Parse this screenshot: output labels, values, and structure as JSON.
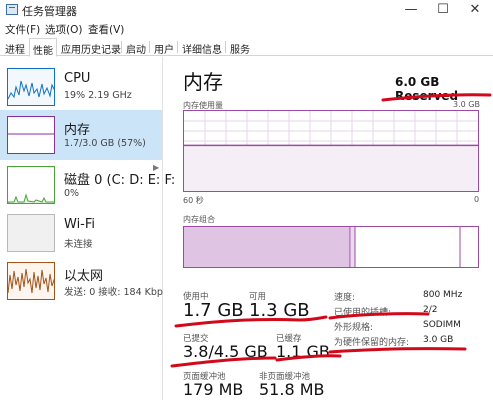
{
  "window": {
    "title": "任务管理器",
    "buttons": {
      "minimize": "—",
      "maximize": "☐",
      "close": "✕"
    }
  },
  "menu": [
    {
      "label": "文件(F)"
    },
    {
      "label": "选项(O)"
    },
    {
      "label": "查看(V)"
    }
  ],
  "tabs": [
    {
      "label": "进程",
      "active": false
    },
    {
      "label": "性能",
      "active": true
    },
    {
      "label": "应用历史记录",
      "active": false
    },
    {
      "label": "启动",
      "active": false
    },
    {
      "label": "用户",
      "active": false
    },
    {
      "label": "详细信息",
      "active": false
    },
    {
      "label": "服务",
      "active": false
    }
  ],
  "sidebar": {
    "items": [
      {
        "title": "CPU",
        "subtitle": "19% 2.19 GHz",
        "color": "#1170c8",
        "selected": false
      },
      {
        "title": "内存",
        "subtitle": "1.7/3.0 GB (57%)",
        "color": "#8b2f9a",
        "selected": true
      },
      {
        "title": "磁盘 0 (C: D: E: F:",
        "subtitle": "0%",
        "color": "#4aa338",
        "selected": false
      },
      {
        "title": "Wi-Fi",
        "subtitle": "未连接",
        "color": "#a0a0a0",
        "selected": false
      },
      {
        "title": "以太网",
        "subtitle": "发送: 0 接收: 184 Kbp",
        "color": "#a1531b",
        "selected": false
      }
    ]
  },
  "main": {
    "title": "内存",
    "reserved": "6.0 GB Reserved",
    "usage_label": "内存使用量",
    "usage_max": "3.0 GB",
    "time_left": "60 秒",
    "time_right": "0",
    "composition_label": "内存组合",
    "graph_color": "#9b4ba3",
    "usage_level_pct": 57
  },
  "stats": {
    "in_use_label": "使用中",
    "in_use_value": "1.7 GB",
    "available_label": "可用",
    "available_value": "1.3 GB",
    "committed_label": "已提交",
    "committed_value": "3.8/4.5 GB",
    "cached_label": "已缓存",
    "cached_value": "1.1 GB",
    "paged_label": "页面缓冲池",
    "paged_value": "179 MB",
    "nonpaged_label": "非页面缓冲池",
    "nonpaged_value": "51.8 MB"
  },
  "info": [
    {
      "key": "速度:",
      "value": "800 MHz"
    },
    {
      "key": "已使用的插槽:",
      "value": "2/2"
    },
    {
      "key": "外形规格:",
      "value": "SODIMM"
    },
    {
      "key": "为硬件保留的内存:",
      "value": "3.0 GB"
    }
  ],
  "annotation_color": "#d1091b"
}
